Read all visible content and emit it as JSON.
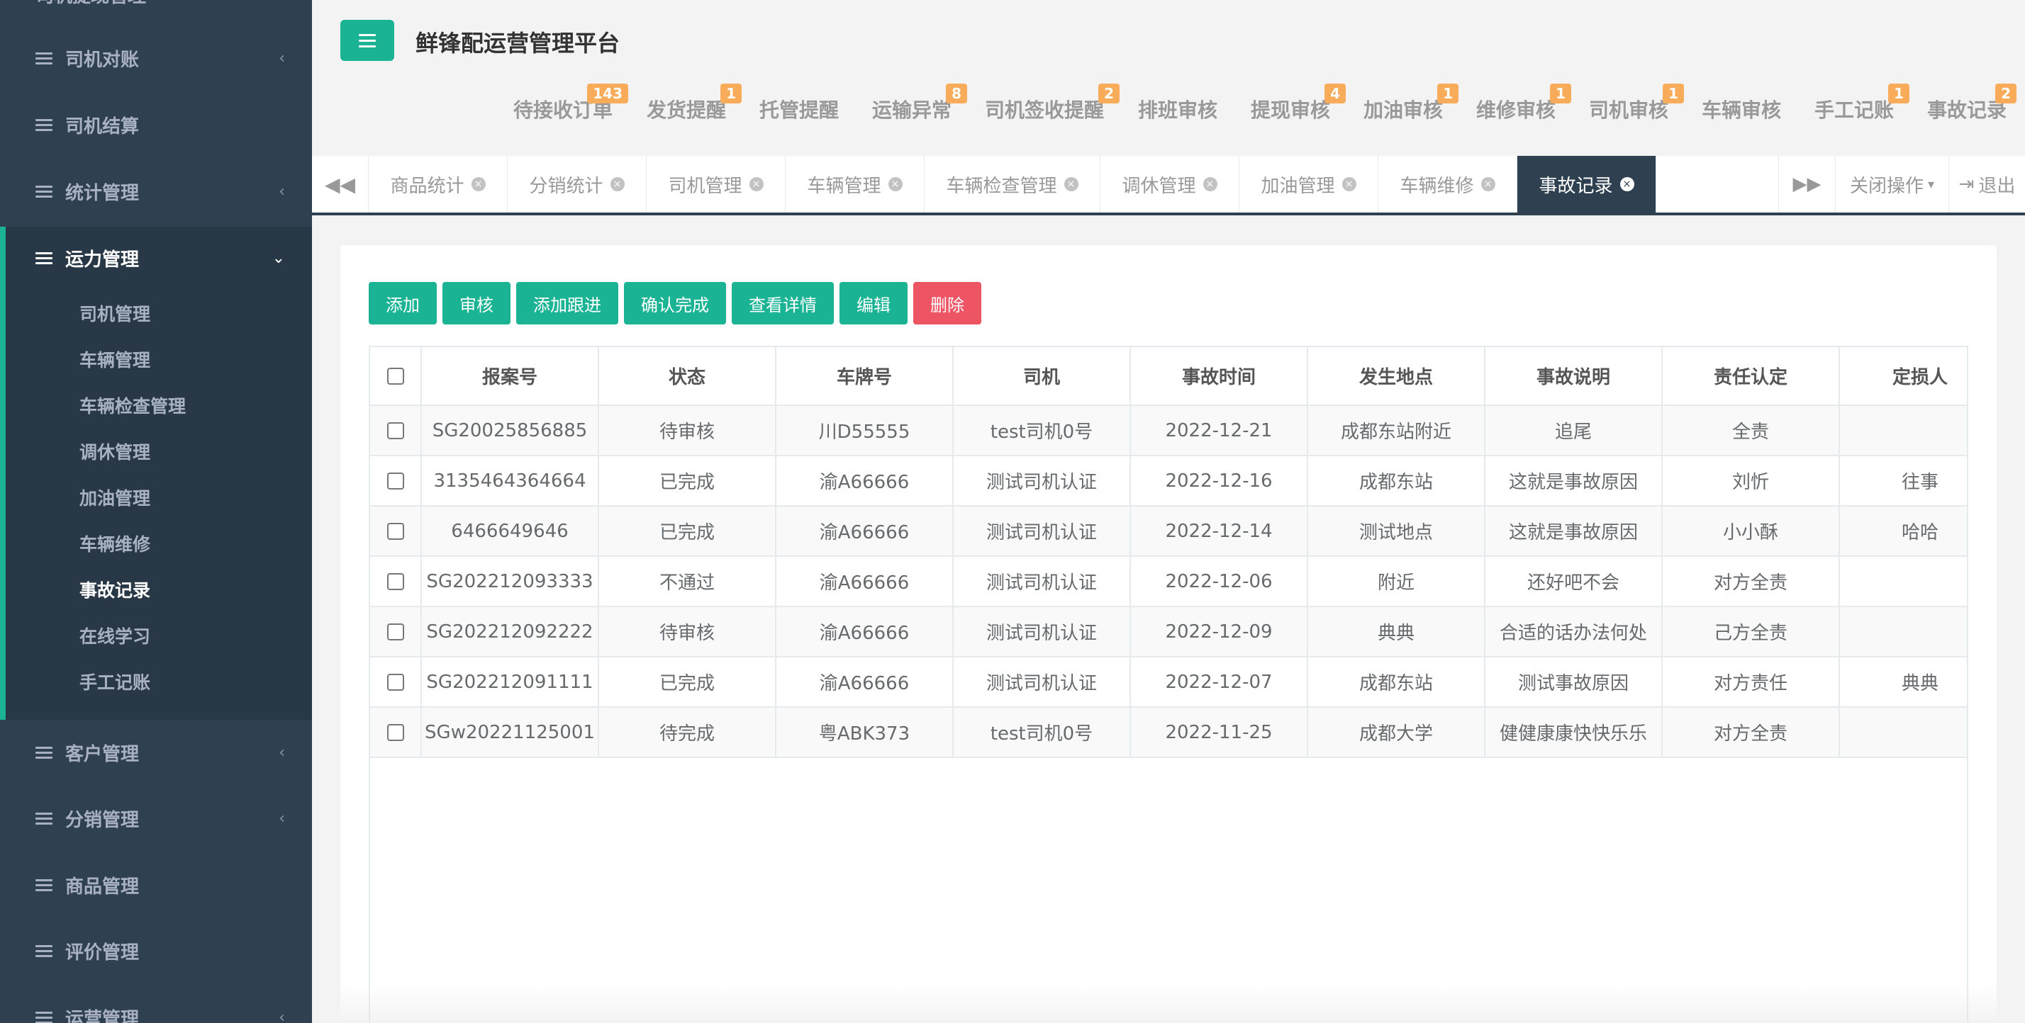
{
  "app": {
    "title": "鲜锋配运营管理平台"
  },
  "sidebar": {
    "partial_top": "司机提现管理",
    "items": [
      {
        "label": "司机对账",
        "has_chevron": true
      },
      {
        "label": "司机结算",
        "has_chevron": false
      },
      {
        "label": "统计管理",
        "has_chevron": true
      },
      {
        "label": "运力管理",
        "expanded": true
      },
      {
        "label": "客户管理",
        "has_chevron": true
      },
      {
        "label": "分销管理",
        "has_chevron": true
      },
      {
        "label": "商品管理",
        "has_chevron": false
      },
      {
        "label": "评价管理",
        "has_chevron": false
      },
      {
        "label": "运营管理",
        "has_chevron": true
      }
    ],
    "subitems": [
      "司机管理",
      "车辆管理",
      "车辆检查管理",
      "调休管理",
      "加油管理",
      "车辆维修",
      "事故记录",
      "在线学习",
      "手工记账"
    ],
    "current_subitem": "事故记录"
  },
  "notifications": [
    {
      "label": "待接收订单",
      "badge": "143"
    },
    {
      "label": "发货提醒",
      "badge": "1"
    },
    {
      "label": "托管提醒",
      "badge": ""
    },
    {
      "label": "运输异常",
      "badge": "8"
    },
    {
      "label": "司机签收提醒",
      "badge": "2"
    },
    {
      "label": "排班审核",
      "badge": ""
    },
    {
      "label": "提现审核",
      "badge": "4"
    },
    {
      "label": "加油审核",
      "badge": "1"
    },
    {
      "label": "维修审核",
      "badge": "1"
    },
    {
      "label": "司机审核",
      "badge": "1"
    },
    {
      "label": "车辆审核",
      "badge": ""
    },
    {
      "label": "手工记账",
      "badge": "1"
    },
    {
      "label": "事故记录",
      "badge": "2"
    }
  ],
  "tabs": [
    {
      "label": "商品统计",
      "active": false
    },
    {
      "label": "分销统计",
      "active": false
    },
    {
      "label": "司机管理",
      "active": false
    },
    {
      "label": "车辆管理",
      "active": false
    },
    {
      "label": "车辆检查管理",
      "active": false
    },
    {
      "label": "调休管理",
      "active": false
    },
    {
      "label": "加油管理",
      "active": false
    },
    {
      "label": "车辆维修",
      "active": false
    },
    {
      "label": "事故记录",
      "active": true
    }
  ],
  "tab_controls": {
    "close_ops": "关闭操作",
    "logout": "退出"
  },
  "toolbar": {
    "add": "添加",
    "audit": "审核",
    "add_followup": "添加跟进",
    "confirm_done": "确认完成",
    "view_detail": "查看详情",
    "edit": "编辑",
    "delete": "删除"
  },
  "table": {
    "columns": [
      "报案号",
      "状态",
      "车牌号",
      "司机",
      "事故时间",
      "发生地点",
      "事故说明",
      "责任认定",
      "定损人"
    ],
    "rows": [
      [
        "SG20025856885",
        "待审核",
        "川D55555",
        "test司机0号",
        "2022-12-21",
        "成都东站附近",
        "追尾",
        "全责",
        ""
      ],
      [
        "3135464364664",
        "已完成",
        "渝A66666",
        "测试司机认证",
        "2022-12-16",
        "成都东站",
        "这就是事故原因",
        "刘忻",
        "往事"
      ],
      [
        "6466649646",
        "已完成",
        "渝A66666",
        "测试司机认证",
        "2022-12-14",
        "测试地点",
        "这就是事故原因",
        "小小酥",
        "哈哈"
      ],
      [
        "SG202212093333",
        "不通过",
        "渝A66666",
        "测试司机认证",
        "2022-12-06",
        "附近",
        "还好吧不会",
        "对方全责",
        ""
      ],
      [
        "SG202212092222",
        "待审核",
        "渝A66666",
        "测试司机认证",
        "2022-12-09",
        "典典",
        "合适的话办法何处",
        "己方全责",
        ""
      ],
      [
        "SG202212091111",
        "已完成",
        "渝A66666",
        "测试司机认证",
        "2022-12-07",
        "成都东站",
        "测试事故原因",
        "对方责任",
        "典典"
      ],
      [
        "SGw20221125001",
        "待完成",
        "粤ABK373",
        "test司机0号",
        "2022-11-25",
        "成都大学",
        "健健康康快快乐乐",
        "对方全责",
        ""
      ]
    ]
  },
  "colors": {
    "primary": "#1ab394",
    "danger": "#ed5565",
    "sidebar_bg": "#2f4050",
    "badge": "#f8ac59"
  }
}
